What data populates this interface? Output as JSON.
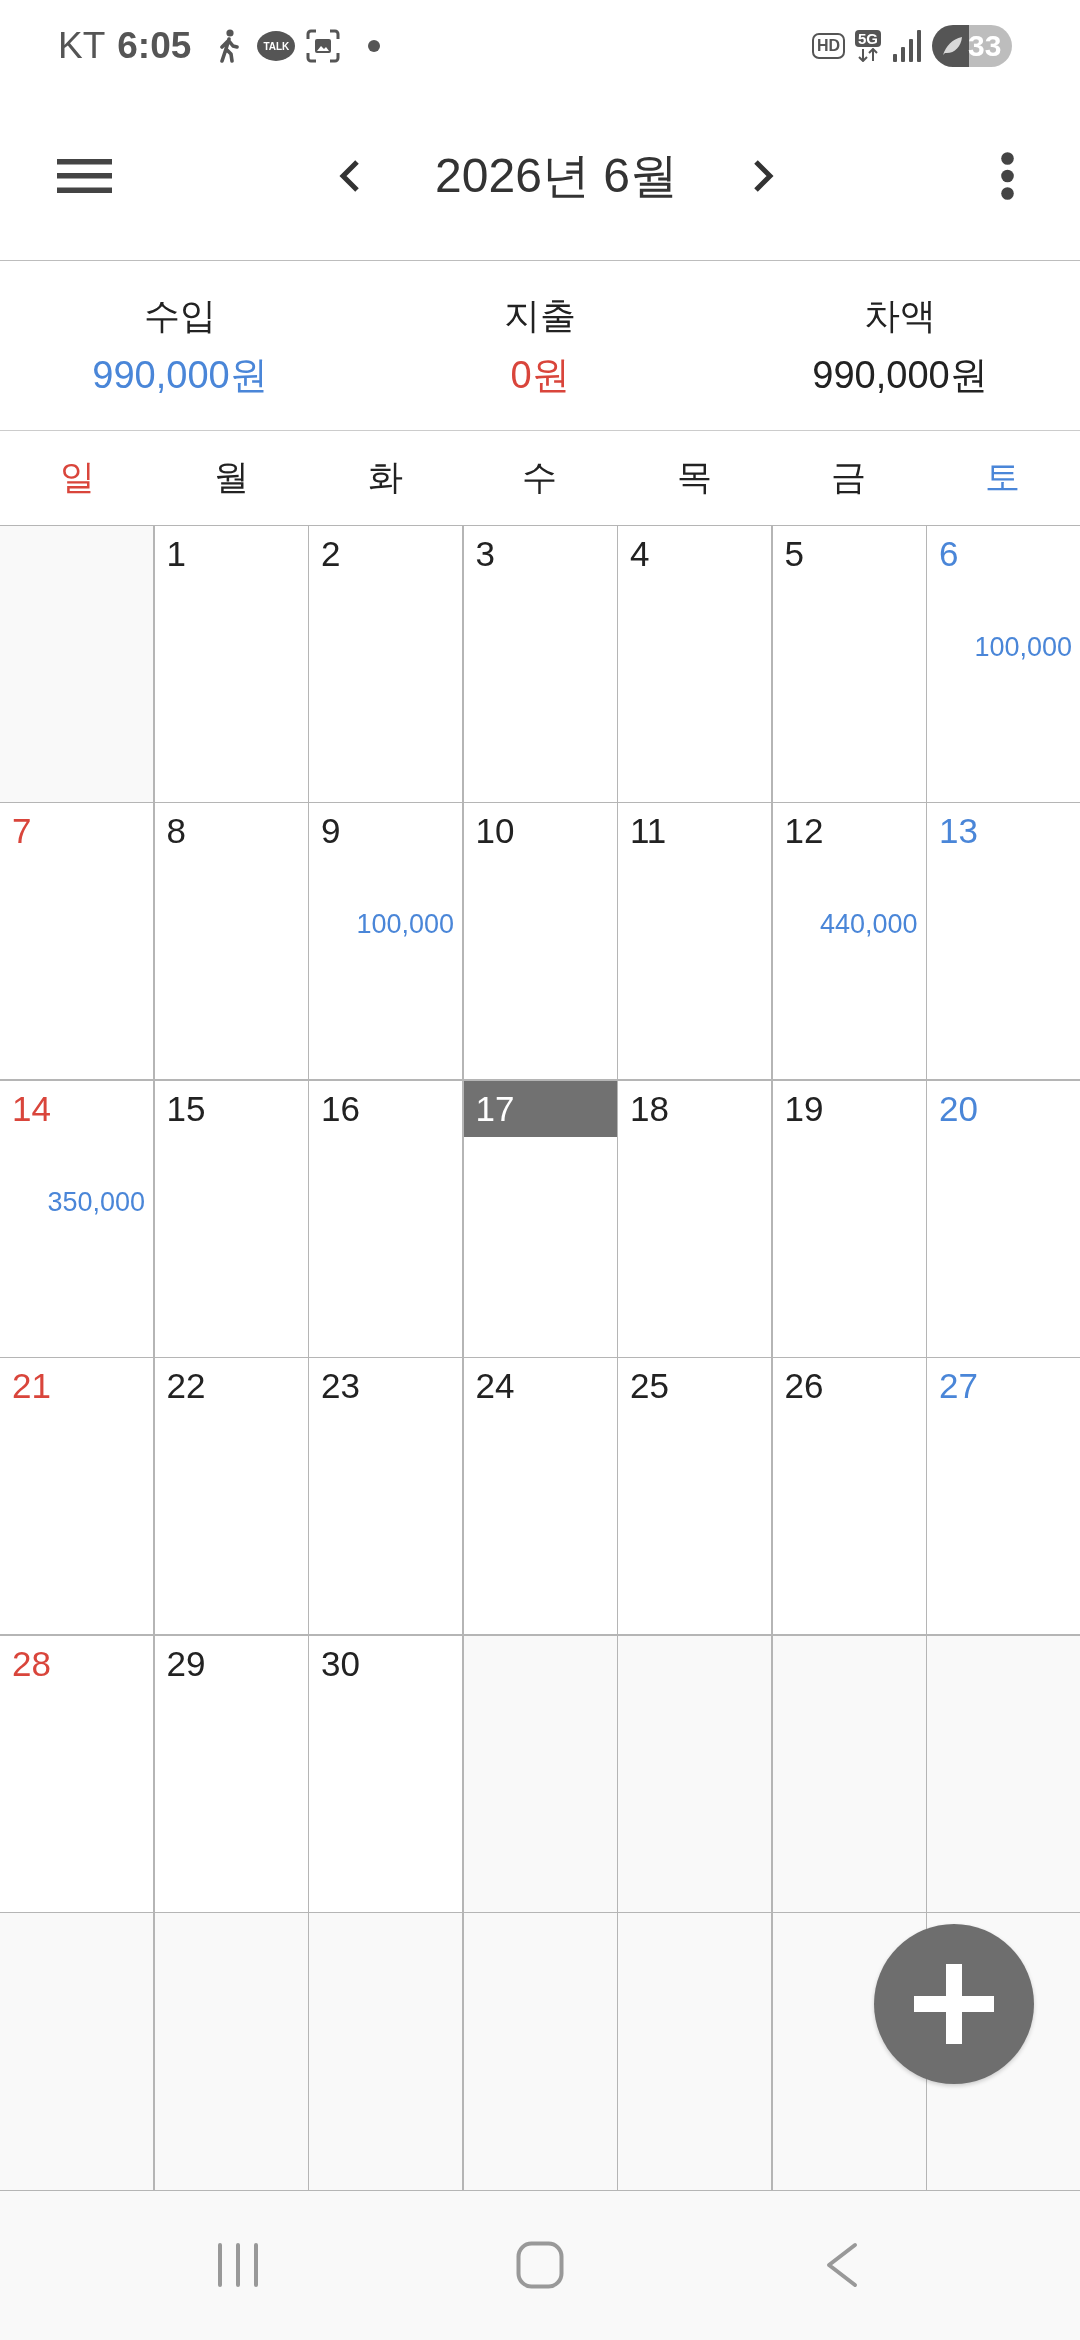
{
  "status_bar": {
    "carrier": "KT",
    "time": "6:05",
    "chat_badge": "TALK",
    "hd_badge": "HD",
    "network": "5G",
    "battery": "33"
  },
  "header": {
    "title": "2026년 6월"
  },
  "summary": [
    {
      "kind": "income",
      "label": "수입",
      "value": "990,000원"
    },
    {
      "kind": "expense",
      "label": "지출",
      "value": "0원"
    },
    {
      "kind": "balance",
      "label": "차액",
      "value": "990,000원"
    }
  ],
  "weekdays": [
    {
      "label": "일",
      "color": "#d9453b"
    },
    {
      "label": "월",
      "color": "#222222"
    },
    {
      "label": "화",
      "color": "#222222"
    },
    {
      "label": "수",
      "color": "#222222"
    },
    {
      "label": "목",
      "color": "#222222"
    },
    {
      "label": "금",
      "color": "#222222"
    },
    {
      "label": "토",
      "color": "#4a86d8"
    }
  ],
  "weeks": [
    [
      {
        "kind": "blank"
      },
      {
        "kind": "day",
        "day": "1",
        "selected": false
      },
      {
        "kind": "day",
        "day": "2",
        "selected": false
      },
      {
        "kind": "day",
        "day": "3",
        "selected": false
      },
      {
        "kind": "day",
        "day": "4",
        "selected": false
      },
      {
        "kind": "day",
        "day": "5",
        "selected": false
      },
      {
        "kind": "day",
        "day": "6",
        "selected": false,
        "amount": "100,000"
      }
    ],
    [
      {
        "kind": "day",
        "day": "7",
        "selected": false
      },
      {
        "kind": "day",
        "day": "8",
        "selected": false
      },
      {
        "kind": "day",
        "day": "9",
        "selected": false,
        "amount": "100,000"
      },
      {
        "kind": "day",
        "day": "10",
        "selected": false
      },
      {
        "kind": "day",
        "day": "11",
        "selected": false
      },
      {
        "kind": "day",
        "day": "12",
        "selected": false,
        "amount": "440,000"
      },
      {
        "kind": "day",
        "day": "13",
        "selected": false
      }
    ],
    [
      {
        "kind": "day",
        "day": "14",
        "selected": false,
        "amount": "350,000"
      },
      {
        "kind": "day",
        "day": "15",
        "selected": false
      },
      {
        "kind": "day",
        "day": "16",
        "selected": false
      },
      {
        "kind": "day",
        "day": "17",
        "selected": true
      },
      {
        "kind": "day",
        "day": "18",
        "selected": false
      },
      {
        "kind": "day",
        "day": "19",
        "selected": false
      },
      {
        "kind": "day",
        "day": "20",
        "selected": false
      }
    ],
    [
      {
        "kind": "day",
        "day": "21",
        "selected": false
      },
      {
        "kind": "day",
        "day": "22",
        "selected": false
      },
      {
        "kind": "day",
        "day": "23",
        "selected": false
      },
      {
        "kind": "day",
        "day": "24",
        "selected": false
      },
      {
        "kind": "day",
        "day": "25",
        "selected": false
      },
      {
        "kind": "day",
        "day": "26",
        "selected": false
      },
      {
        "kind": "day",
        "day": "27",
        "selected": false
      }
    ],
    [
      {
        "kind": "day",
        "day": "28",
        "selected": false
      },
      {
        "kind": "day",
        "day": "29",
        "selected": false
      },
      {
        "kind": "day",
        "day": "30",
        "selected": false
      },
      {
        "kind": "blank"
      },
      {
        "kind": "blank"
      },
      {
        "kind": "blank"
      },
      {
        "kind": "blank"
      }
    ],
    [
      {
        "kind": "blank"
      },
      {
        "kind": "blank"
      },
      {
        "kind": "blank"
      },
      {
        "kind": "blank"
      },
      {
        "kind": "blank"
      },
      {
        "kind": "blank"
      },
      {
        "kind": "blank"
      }
    ]
  ]
}
